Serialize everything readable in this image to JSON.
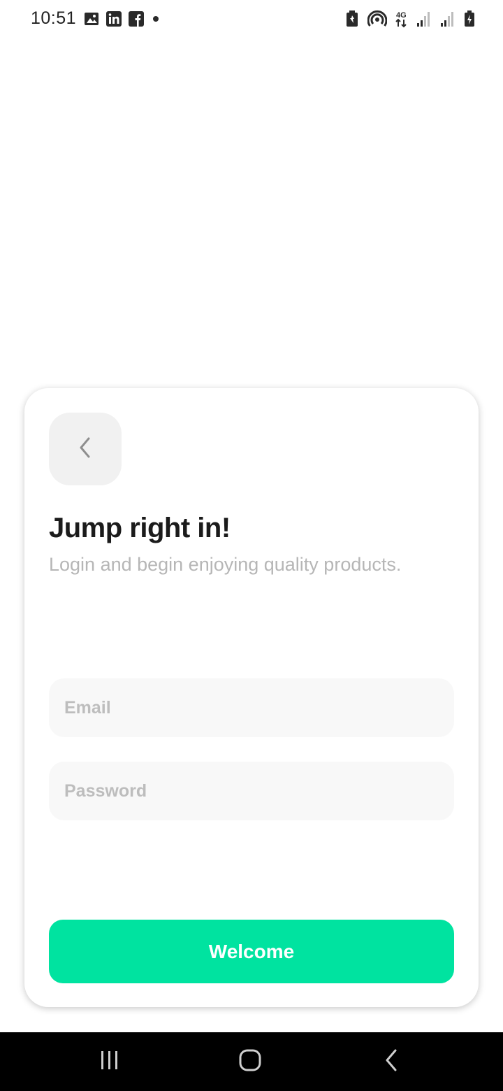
{
  "status_bar": {
    "time": "10:51",
    "left_icons": [
      "gallery-icon",
      "linkedin-icon",
      "facebook-icon",
      "dot-icon"
    ],
    "right_icons": [
      "battery-saver-icon",
      "hotspot-icon",
      "network-4g-icon",
      "signal-icon",
      "signal-icon",
      "battery-charging-icon"
    ],
    "network_label": "4G"
  },
  "login_card": {
    "back_icon": "chevron-left-icon",
    "title": "Jump right in!",
    "subtitle": "Login and begin enjoying quality products.",
    "email": {
      "placeholder": "Email",
      "value": ""
    },
    "password": {
      "placeholder": "Password",
      "value": ""
    },
    "submit_label": "Welcome"
  },
  "nav_bar": {
    "buttons": [
      "recents-icon",
      "home-icon",
      "back-icon"
    ]
  },
  "colors": {
    "accent": "#00e3a0",
    "title": "#1b1b1b",
    "subtitle": "#b6b6b6",
    "field_bg": "#f8f8f8",
    "back_button_bg": "#f1f1f1",
    "nav_bar_bg": "#000000"
  }
}
